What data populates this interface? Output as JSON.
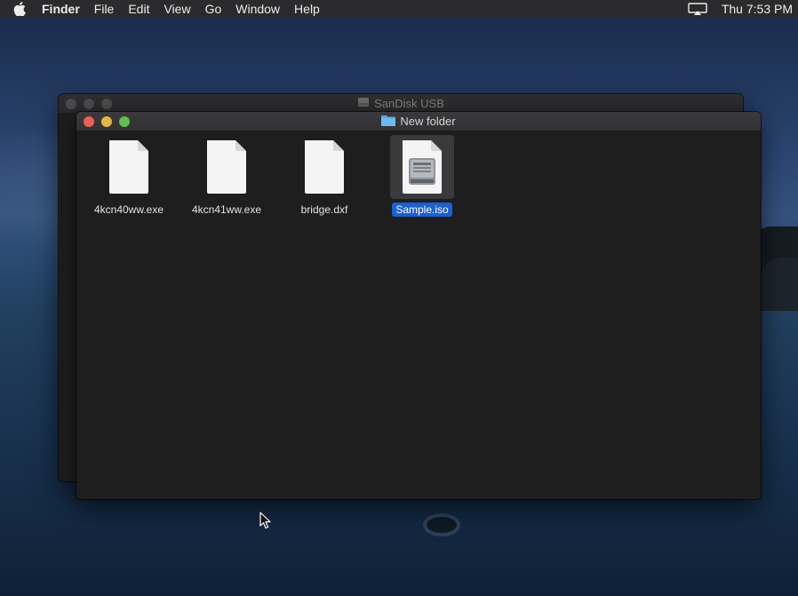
{
  "menubar": {
    "app_name": "Finder",
    "items": [
      "File",
      "Edit",
      "View",
      "Go",
      "Window",
      "Help"
    ],
    "clock": "Thu 7:53 PM"
  },
  "back_window": {
    "title": "SanDisk USB"
  },
  "front_window": {
    "title": "New folder",
    "files": [
      {
        "name": "4kcn40ww.exe",
        "icon": "document-icon",
        "selected": false
      },
      {
        "name": "4kcn41ww.exe",
        "icon": "document-icon",
        "selected": false
      },
      {
        "name": "bridge.dxf",
        "icon": "document-icon",
        "selected": false
      },
      {
        "name": "Sample.iso",
        "icon": "disk-image-icon",
        "selected": true
      }
    ]
  },
  "colors": {
    "selection": "#1d5fd0",
    "close": "#ed5f57",
    "minimize": "#e5b73f",
    "zoom": "#5fc14a"
  }
}
